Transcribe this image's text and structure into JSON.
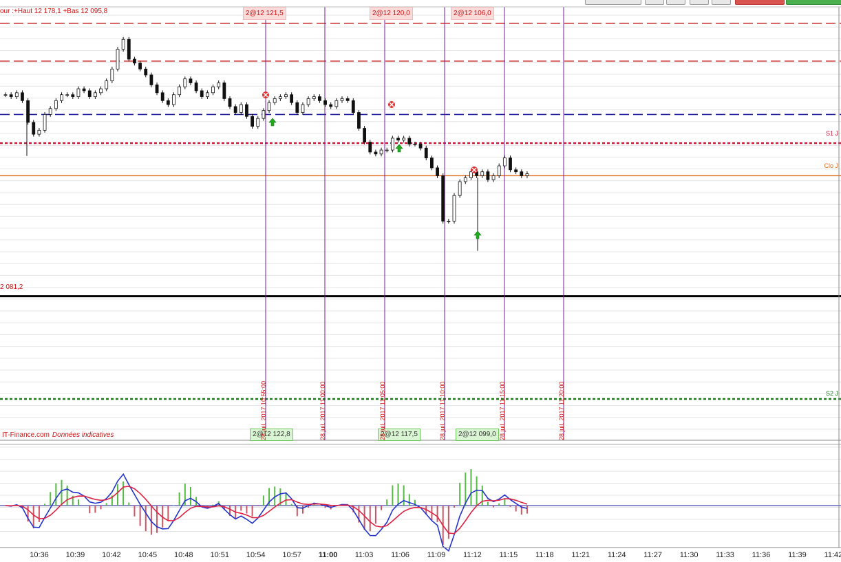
{
  "toolbar": {
    "buttons": [
      "",
      "",
      "",
      "",
      "",
      "",
      ""
    ]
  },
  "header": {
    "info": "our :+Haut 12 178,1 +Bas 12 095,8"
  },
  "orders_top": [
    "2@12 121,5",
    "2@12 120,0",
    "2@12 106,0"
  ],
  "orders_bottom": [
    "2@12 122,8",
    "2@12 117,5",
    "2@12 099,0"
  ],
  "level_labels": {
    "s1": "S1 J",
    "clo": "Clo J",
    "s2": "S2 J",
    "left_price": "2 081,2"
  },
  "watermark": {
    "brand": "IT-Finance.com",
    "note": "Données indicatives"
  },
  "vertical_times": [
    "28 juil. 2017 10:55:00",
    "28 juil. 2017 11:00:00",
    "28 juil. 2017 11:05:00",
    "28 juil. 2017 11:10:00",
    "28 juil. 2017 11:15:00",
    "28 juil. 2017 11:20:00"
  ],
  "x_ticks": [
    "10:36",
    "10:39",
    "10:42",
    "10:45",
    "10:48",
    "10:51",
    "10:54",
    "10:57",
    "11:00",
    "11:03",
    "11:06",
    "11:09",
    "11:12",
    "11:15",
    "11:18",
    "11:21",
    "11:24",
    "11:27",
    "11:30",
    "11:33",
    "11:36",
    "11:39",
    "11:42"
  ],
  "colors": {
    "red": "#cc1111",
    "blue": "#1a1a9a",
    "orange": "#e07020",
    "green": "#1a7a1a",
    "purple": "#7a1aa0",
    "grid": "#e4e4e4"
  },
  "chart_data": {
    "type": "candlestick",
    "title": "",
    "levels": [
      {
        "name": "resistance-1",
        "style": "dashed",
        "color": "#cc3333",
        "y": 12178.1
      },
      {
        "name": "resistance-2",
        "style": "dashed",
        "color": "#cc3333",
        "y": 12159
      },
      {
        "name": "pivot",
        "style": "dashed",
        "color": "#1a1a9a",
        "y": 12132
      },
      {
        "name": "S1 J",
        "style": "dotted",
        "color": "#cc1133",
        "y": 12117.5
      },
      {
        "name": "Clo J",
        "style": "solid",
        "color": "#e07020",
        "y": 12101
      },
      {
        "name": "2 081,2",
        "style": "solid",
        "color": "#000000",
        "y": 12040
      },
      {
        "name": "S2 J",
        "style": "dotted",
        "color": "#1a7a1a",
        "y": 11988
      }
    ],
    "close_series": [
      12142,
      12141,
      12143,
      12139,
      12128,
      12122,
      12124,
      12132,
      12135,
      12139,
      12142,
      12142,
      12141,
      12145,
      12144,
      12141,
      12143,
      12145,
      12149,
      12155,
      12165,
      12170,
      12160,
      12158,
      12155,
      12152,
      12147,
      12143,
      12139,
      12137,
      12142,
      12146,
      12150,
      12148,
      12144,
      12141,
      12143,
      12146,
      12148,
      12140,
      12136,
      12133,
      12137,
      12131,
      12126,
      12130,
      12134,
      12138,
      12140,
      12141,
      12142,
      12138,
      12133,
      12137,
      12140,
      12141,
      12139,
      12137,
      12136,
      12139,
      12140,
      12139,
      12133,
      12125,
      12118,
      12113,
      12112,
      12114,
      12114,
      12120,
      12119,
      12120,
      12117,
      12117,
      12115,
      12110,
      12105,
      12101,
      12078,
      12078,
      12091,
      12098,
      12100,
      12103,
      12101,
      12103,
      12099,
      12101,
      12106,
      12110,
      12104,
      12103,
      12101,
      12102
    ],
    "signals_entry": [
      "2@12 121,5",
      "2@12 120,0",
      "2@12 106,0"
    ],
    "signals_exit": [
      "2@12 122,8",
      "2@12 117,5",
      "2@12 099,0"
    ]
  }
}
